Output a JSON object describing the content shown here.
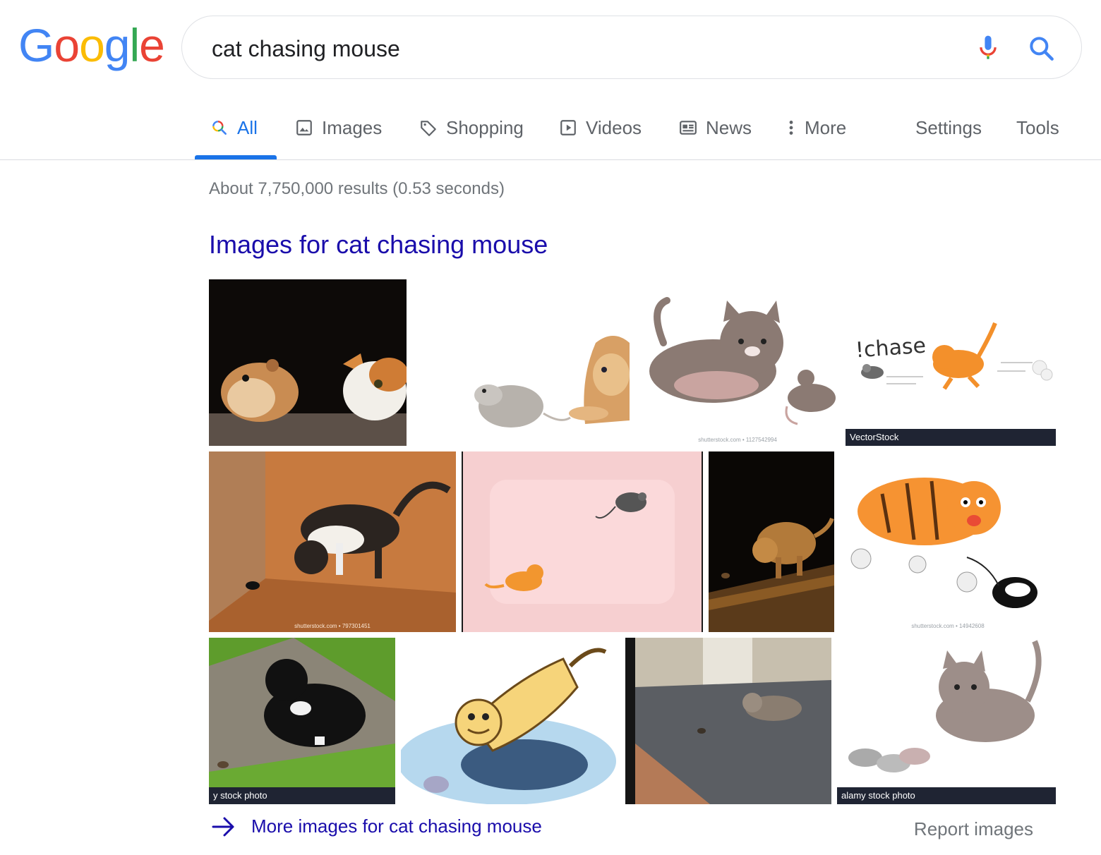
{
  "logo": [
    "G",
    "o",
    "o",
    "g",
    "l",
    "e"
  ],
  "logo_colors": [
    "#4285f4",
    "#ea4335",
    "#fbbc05",
    "#4285f4",
    "#34a853",
    "#ea4335"
  ],
  "search": {
    "query": "cat chasing mouse"
  },
  "tabs": [
    {
      "label": "All",
      "icon": "search-icon"
    },
    {
      "label": "Images",
      "icon": "image-icon"
    },
    {
      "label": "Shopping",
      "icon": "tag-icon"
    },
    {
      "label": "Videos",
      "icon": "play-icon"
    },
    {
      "label": "News",
      "icon": "newspaper-icon"
    },
    {
      "label": "More",
      "icon": "vertical-dots-icon"
    },
    {
      "label": "Settings"
    },
    {
      "label": "Tools"
    }
  ],
  "stats": "About 7,750,000 results (0.53 seconds)",
  "images": {
    "heading": "Images for cat chasing mouse",
    "watermarks": {
      "vectorstock": "VectorStock",
      "alamy_cut": "y stock photo",
      "alamy": "alamy stock photo",
      "shutterstock_1": "shutterstock.com • 1127542994",
      "shutterstock_2": "shutterstock.com • 797301451",
      "shutterstock_3": "shutterstock.com • 14942608"
    },
    "chase_text": "!chase",
    "more_link": "More images for cat chasing mouse",
    "report": "Report images"
  },
  "colors": {
    "accent": "#1a73e8",
    "link": "#1a0dab",
    "muted": "#70757a"
  }
}
